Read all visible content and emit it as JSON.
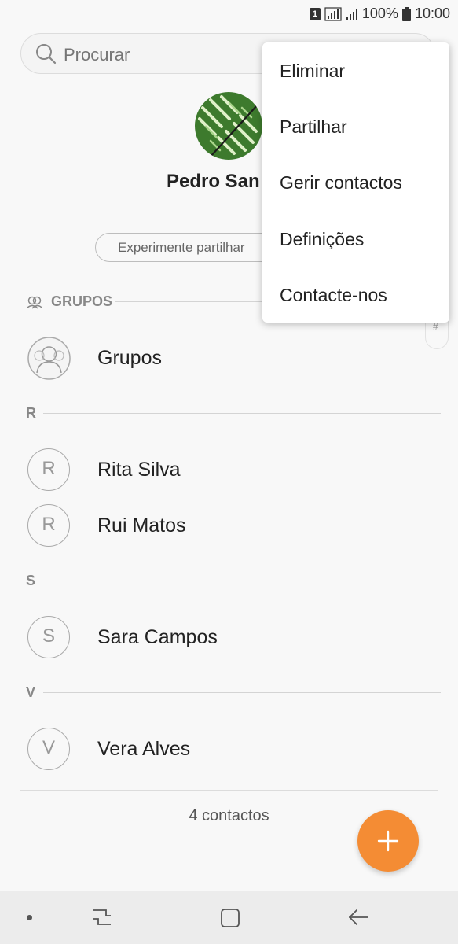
{
  "status_bar": {
    "sim": "1",
    "battery_percent": "100%",
    "time": "10:00"
  },
  "search": {
    "placeholder": "Procurar"
  },
  "profile": {
    "name": "Pedro San"
  },
  "share_prompt": "Experimente partilhar",
  "sections": {
    "groups": {
      "header": "GRUPOS",
      "item": {
        "label": "Grupos"
      }
    },
    "r": {
      "header": "R",
      "contacts": [
        {
          "initial": "R",
          "name": "Rita Silva"
        },
        {
          "initial": "R",
          "name": "Rui Matos"
        }
      ]
    },
    "s": {
      "header": "S",
      "contacts": [
        {
          "initial": "S",
          "name": "Sara Campos"
        }
      ]
    },
    "v": {
      "header": "V",
      "contacts": [
        {
          "initial": "V",
          "name": "Vera Alves"
        }
      ]
    }
  },
  "index_scroller": {
    "symbol": "#"
  },
  "footer": {
    "count": "4 contactos"
  },
  "fab": {
    "icon": "plus-icon",
    "color": "#f48c34"
  },
  "overflow_menu": {
    "items": [
      "Eliminar",
      "Partilhar",
      "Gerir contactos",
      "Definições",
      "Contacte-nos"
    ]
  },
  "nav_bar": {
    "icons": [
      "dot-icon",
      "recents-icon",
      "home-icon",
      "back-icon"
    ]
  }
}
